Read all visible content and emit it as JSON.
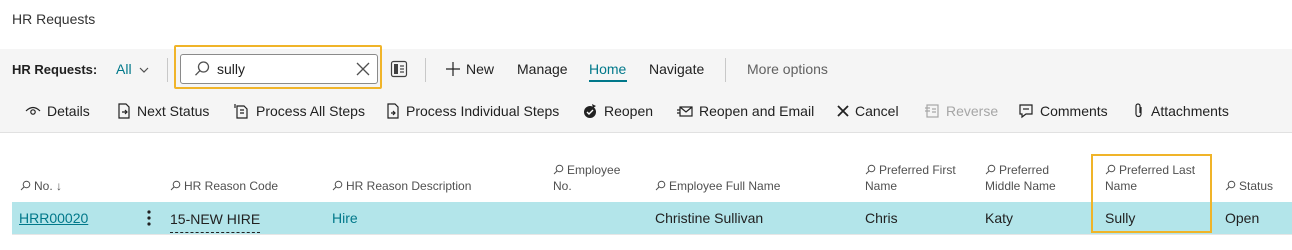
{
  "page": {
    "title": "HR Requests"
  },
  "action_bar": {
    "list_label": "HR Requests:",
    "filter_view": "All",
    "search_value": "sully",
    "new_label": "New",
    "manage_label": "Manage",
    "home_label": "Home",
    "navigate_label": "Navigate",
    "more_options_label": "More options"
  },
  "sub_actions": {
    "details": "Details",
    "next_status": "Next Status",
    "process_all_steps": "Process All Steps",
    "process_individual_steps": "Process Individual Steps",
    "reopen": "Reopen",
    "reopen_and_email": "Reopen and Email",
    "cancel": "Cancel",
    "reverse": "Reverse",
    "comments": "Comments",
    "attachments": "Attachments"
  },
  "table": {
    "columns": {
      "no": "No.",
      "no_sort": "↓",
      "hr_reason_code": "HR Reason Code",
      "hr_reason_description": "HR Reason Description",
      "employee_no_1": "Employee",
      "employee_no_2": "No.",
      "employee_full_name": "Employee Full Name",
      "preferred_first_1": "Preferred First",
      "preferred_first_2": "Name",
      "preferred_middle_1": "Preferred",
      "preferred_middle_2": "Middle Name",
      "preferred_last_1": "Preferred Last",
      "preferred_last_2": "Name",
      "status": "Status"
    },
    "rows": [
      {
        "no": "HRR00020",
        "hr_reason_code": "15-NEW HIRE",
        "hr_reason_description": "Hire",
        "employee_no": "",
        "employee_full_name": "Christine Sullivan",
        "preferred_first_name": "Chris",
        "preferred_middle_name": "Katy",
        "preferred_last_name": "Sully",
        "status": "Open"
      }
    ]
  },
  "colors": {
    "accent": "#00788a",
    "highlight": "#f0b429",
    "selected_row": "#b3e5ea"
  }
}
